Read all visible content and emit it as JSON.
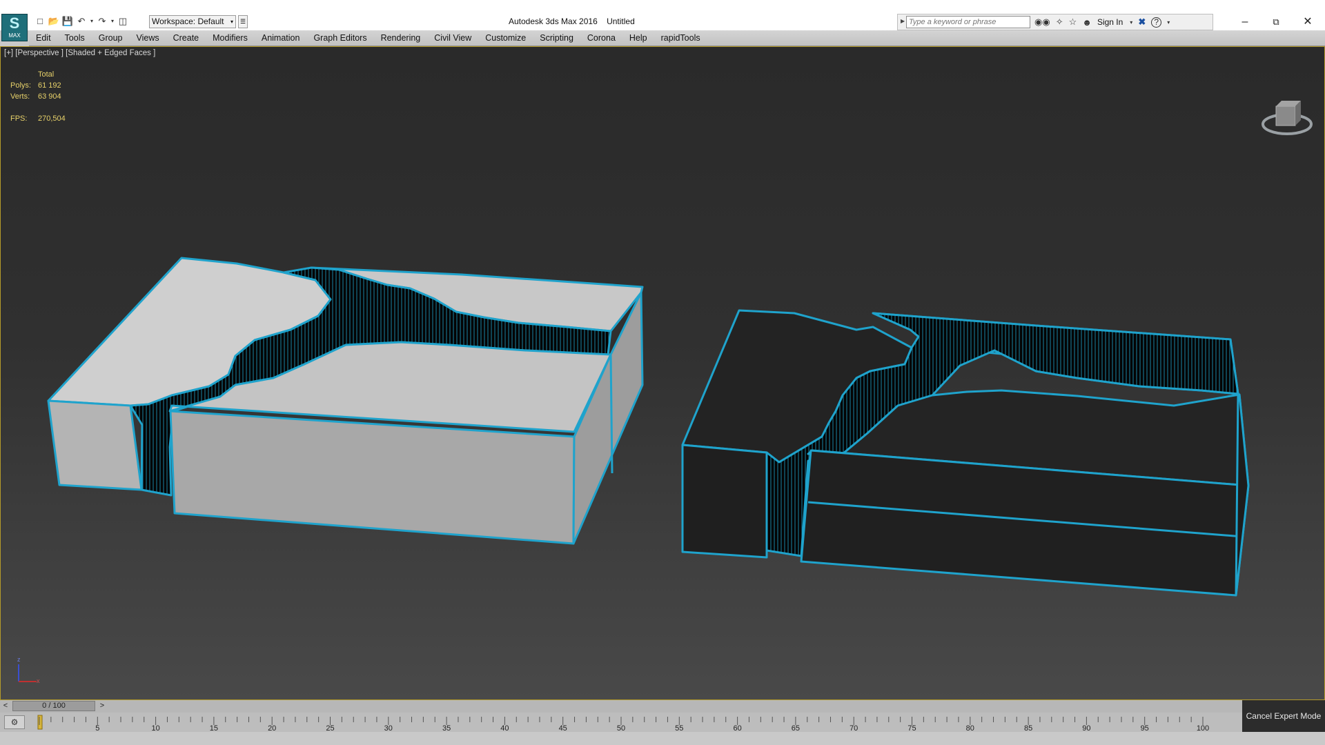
{
  "app": {
    "logo_text": "MAX",
    "title": "Autodesk 3ds Max 2016",
    "document": "Untitled"
  },
  "quick_access": {
    "workspace_label": "Workspace: Default",
    "icons": [
      "new-file-icon",
      "open-file-icon",
      "save-icon",
      "undo-icon",
      "redo-icon",
      "project-folder-icon"
    ]
  },
  "search": {
    "placeholder": "Type a keyword or phrase",
    "sign_in": "Sign In"
  },
  "menu": {
    "items": [
      "Edit",
      "Tools",
      "Group",
      "Views",
      "Create",
      "Modifiers",
      "Animation",
      "Graph Editors",
      "Rendering",
      "Civil View",
      "Customize",
      "Scripting",
      "Corona",
      "Help",
      "rapidTools"
    ]
  },
  "viewport": {
    "label": "[+] [Perspective ] [Shaded + Edged Faces ]",
    "stats": {
      "header": "Total",
      "polys_label": "Polys:",
      "polys": "61 192",
      "verts_label": "Verts:",
      "verts": "63 904",
      "fps_label": "FPS:",
      "fps": "270,504"
    },
    "axis": {
      "z": "z",
      "x": "x"
    },
    "colors": {
      "edge": "#1fa3cc",
      "light_box": "#c2c2c2",
      "dark_box": "#232323",
      "canyon": "#050505"
    }
  },
  "timeline": {
    "frame_label": "0 / 100",
    "prev": "<",
    "next": ">",
    "ticks": [
      "0",
      "5",
      "10",
      "15",
      "20",
      "25",
      "30",
      "35",
      "40",
      "45",
      "50",
      "55",
      "60",
      "65",
      "70",
      "75",
      "80",
      "85",
      "90",
      "95",
      "100"
    ]
  },
  "status": {
    "cancel_expert": "Cancel Expert Mode"
  }
}
